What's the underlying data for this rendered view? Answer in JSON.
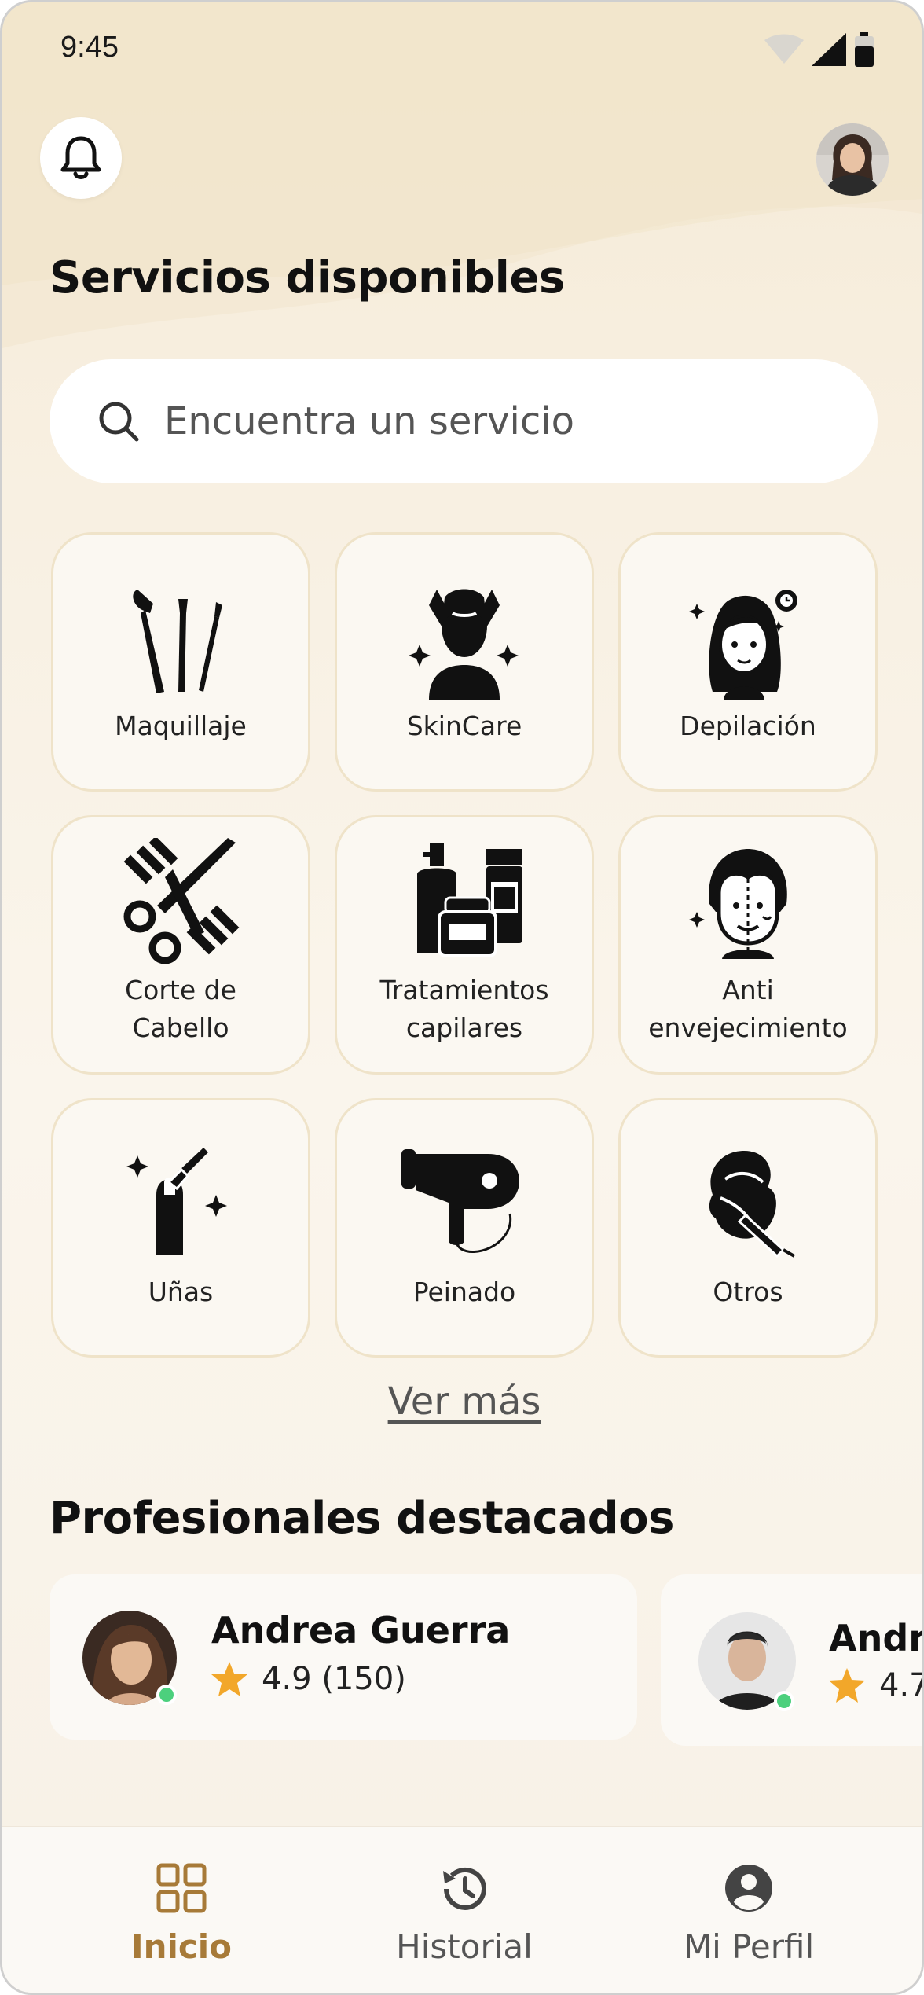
{
  "status_bar": {
    "time": "9:45"
  },
  "header": {
    "notifications_icon": "bell-icon",
    "profile_icon": "avatar"
  },
  "services": {
    "title": "Servicios disponibles",
    "search_placeholder": "Encuentra un servicio",
    "items": [
      {
        "label": "Maquillaje",
        "icon": "makeup-brushes-icon"
      },
      {
        "label": "SkinCare",
        "icon": "face-massage-icon"
      },
      {
        "label": "Depilación",
        "icon": "woman-face-icon"
      },
      {
        "label_line1": "Corte de",
        "label_line2": "Cabello",
        "icon": "scissors-comb-icon"
      },
      {
        "label_line1": "Tratamientos",
        "label_line2": "capilares",
        "icon": "hair-products-icon"
      },
      {
        "label_line1": "Anti",
        "label_line2": "envejecimiento",
        "icon": "aging-face-icon"
      },
      {
        "label": "Uñas",
        "icon": "nail-polish-icon"
      },
      {
        "label": "Peinado",
        "icon": "hair-dryer-icon"
      },
      {
        "label": "Otros",
        "icon": "hair-towel-syringe-icon"
      }
    ],
    "see_more": "Ver más"
  },
  "professionals": {
    "title": "Profesionales destacados",
    "items": [
      {
        "name": "Andrea Guerra",
        "rating": "4.9 (150)"
      },
      {
        "name": "Andre",
        "rating": "4.7"
      }
    ]
  },
  "bottom_nav": {
    "items": [
      {
        "label": "Inicio",
        "icon": "grid-icon",
        "active": true
      },
      {
        "label": "Historial",
        "icon": "history-icon",
        "active": false
      },
      {
        "label": "Mi Perfil",
        "icon": "user-circle-icon",
        "active": false
      }
    ]
  },
  "colors": {
    "accent": "#a77a38",
    "star": "#f2a72a",
    "online": "#4cd07d",
    "card_border": "#efe3c9"
  }
}
